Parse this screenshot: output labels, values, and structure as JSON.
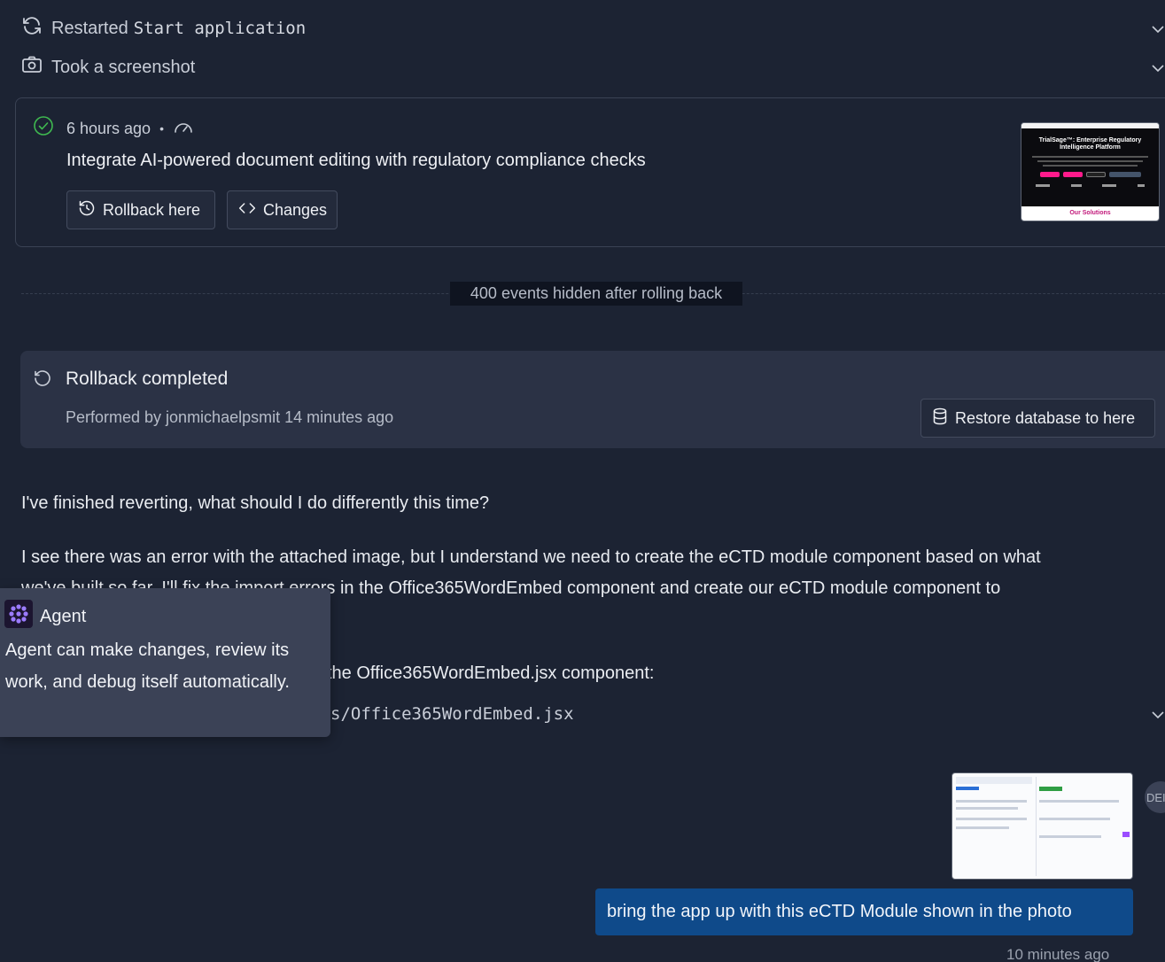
{
  "actions": [
    {
      "label": "Restarted",
      "command": "Start application",
      "icon": "restart-icon"
    },
    {
      "label": "Took a screenshot",
      "icon": "camera-icon"
    }
  ],
  "checkpoint": {
    "time": "6 hours ago",
    "separator": "•",
    "title": "Integrate AI-powered document editing with regulatory compliance checks",
    "rollback_label": "Rollback here",
    "changes_label": "Changes",
    "thumbnail": {
      "heading": "TrialSage™: Enterprise Regulatory Intelligence Platform",
      "footer": "Our Solutions"
    }
  },
  "divider": {
    "label": "400 events hidden after rolling back"
  },
  "rollback": {
    "title": "Rollback completed",
    "performed_by": "Performed by jonmichaelpsmit 14 minutes ago",
    "restore_label": "Restore database to here"
  },
  "messages": {
    "question": "I've finished reverting, what should I do differently this time?",
    "answer_line1": "I see there was an error with the attached image, but I understand we need to create the eCTD module component based on what",
    "answer_line2": "we've built so far. I'll fix the import errors in the Office365WordEmbed component and create our eCTD module component to",
    "answer_line4": "the Office365WordEmbed.jsx component:",
    "file_path": "s/Office365WordEmbed.jsx"
  },
  "tooltip": {
    "title": "Agent",
    "body": "Agent can make changes, review its work, and debug itself automatically."
  },
  "user": {
    "avatar_text": "DEI",
    "message": "bring the app up with this eCTD Module shown in the photo",
    "timestamp": "10 minutes ago"
  },
  "colors": {
    "background": "#1c2333",
    "user_bubble": "#0f4a8a",
    "success": "#3fb950",
    "tooltip_bg": "#3b4256",
    "agent_icon": "#7c5cff"
  }
}
